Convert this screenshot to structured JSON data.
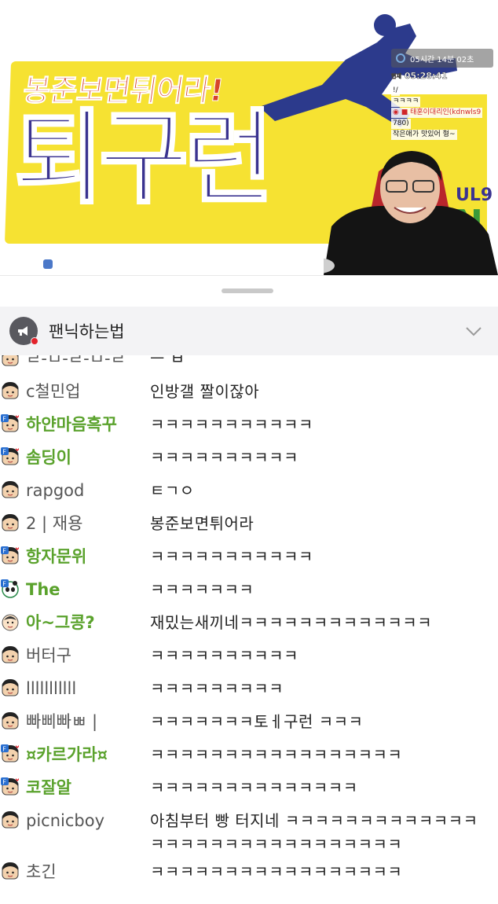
{
  "video": {
    "slogan": "봉준보면튀어라!",
    "big_title": "퇴구런",
    "side_brand_top": "UL9",
    "side_brand_bottom": "N",
    "overlay": {
      "timer": "05시간 14분 02초",
      "clock_tag": "현재",
      "clock": "05:28:41",
      "chat_lines": [
        {
          "text": "!/",
          "red": false
        },
        {
          "text": "ㅋㅋㅋㅋ",
          "red": false
        },
        {
          "text": "◉ ■ 태훈이대리인(kdnwls9",
          "red": true
        },
        {
          "text": "780)",
          "red": false
        },
        {
          "text": "작은애가 맛있어 형~",
          "red": false
        }
      ]
    }
  },
  "notice": {
    "title": "팬닉하는법",
    "icon": "megaphone-icon",
    "expand_icon": "chevron-down-icon"
  },
  "colors": {
    "fan_nick": "#5aa22c",
    "nick": "#555555",
    "notice_bg": "#f3f3f5",
    "badge_red": "#e3222b"
  },
  "chat": {
    "messages": [
      {
        "nick": "ㄹ-ㅁ-ㄹ-ㅁ-ㄹ",
        "text": "ㅡ ㅂ",
        "fan": false,
        "badge": "none"
      },
      {
        "nick": "c철민업",
        "text": "인방갤 짤이잖아",
        "fan": false,
        "badge": "none"
      },
      {
        "nick": "하얀마음흑꾸",
        "text": "ㅋㅋㅋㅋㅋㅋㅋㅋㅋㅋㅋ",
        "fan": true,
        "badge": "fan"
      },
      {
        "nick": "솜딩이",
        "text": "ㅋㅋㅋㅋㅋㅋㅋㅋㅋㅋ",
        "fan": true,
        "badge": "fan"
      },
      {
        "nick": "rapgod",
        "text": "ㅌㄱㅇ",
        "fan": false,
        "badge": "none"
      },
      {
        "nick": "2 | 재용",
        "text": "봉준보면튀어라",
        "fan": false,
        "badge": "none"
      },
      {
        "nick": "항자문위",
        "text": "ㅋㅋㅋㅋㅋㅋㅋㅋㅋㅋㅋ",
        "fan": true,
        "badge": "fan"
      },
      {
        "nick": "The",
        "text": "ㅋㅋㅋㅋㅋㅋㅋ",
        "fan": true,
        "badge": "fan-panda"
      },
      {
        "nick": "아~그콩?",
        "text": "재밌는새끼네ㅋㅋㅋㅋㅋㅋㅋㅋㅋㅋㅋㅋㅋ",
        "fan": true,
        "badge": "face"
      },
      {
        "nick": "버터구",
        "text": "ㅋㅋㅋㅋㅋㅋㅋㅋㅋㅋ",
        "fan": false,
        "badge": "none"
      },
      {
        "nick": "lllllllllll",
        "text": "ㅋㅋㅋㅋㅋㅋㅋㅋㅋ",
        "fan": false,
        "badge": "none"
      },
      {
        "nick": "빠삐빠ㅃ |",
        "text": "ㅋㅋㅋㅋㅋㅋㅋ토ㅔ구런 ㅋㅋㅋ",
        "fan": false,
        "badge": "none"
      },
      {
        "nick": "¤카르가라¤",
        "text": "ㅋㅋㅋㅋㅋㅋㅋㅋㅋㅋㅋㅋㅋㅋㅋㅋㅋ",
        "fan": true,
        "badge": "fan"
      },
      {
        "nick": "코잘알",
        "text": "ㅋㅋㅋㅋㅋㅋㅋㅋㅋㅋㅋㅋㅋㅋ",
        "fan": true,
        "badge": "fan"
      },
      {
        "nick": "picnicboy",
        "text": "아침부터 빵 터지네 ㅋㅋㅋㅋㅋㅋㅋㅋㅋㅋㅋㅋㅋㅋㅋㅋㅋㅋㅋㅋㅋㅋㅋㅋㅋㅋㅋㅋㅋㅋ",
        "fan": false,
        "badge": "none"
      },
      {
        "nick": "초긴",
        "text": "ㅋㅋㅋㅋㅋㅋㅋㅋㅋㅋㅋㅋㅋㅋㅋㅋㅋ",
        "fan": false,
        "badge": "none"
      }
    ]
  }
}
